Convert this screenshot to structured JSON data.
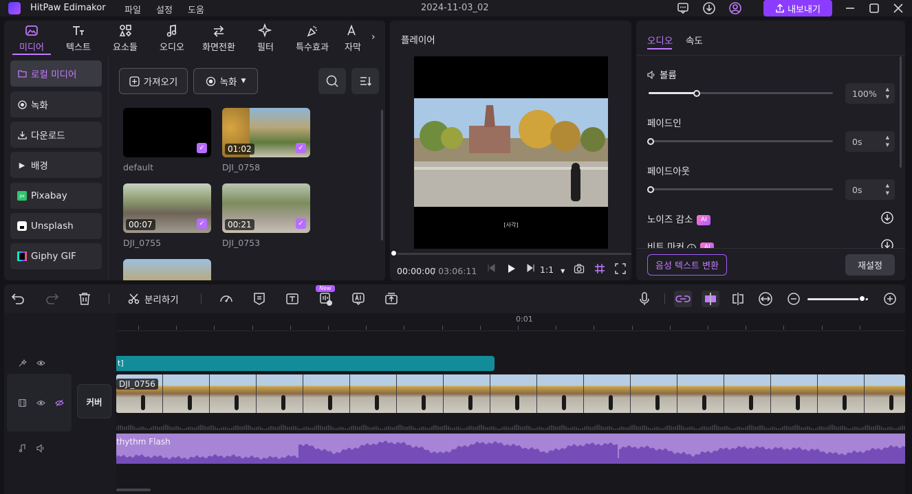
{
  "titlebar": {
    "app_name": "HitPaw Edimakor",
    "menu": [
      "파일",
      "설정",
      "도움"
    ],
    "doc_title": "2024-11-03_02",
    "export_label": "내보내기"
  },
  "tabs": [
    {
      "label": "미디어",
      "icon": "media-icon",
      "active": true
    },
    {
      "label": "텍스트",
      "icon": "text-icon"
    },
    {
      "label": "요소들",
      "icon": "elements-icon"
    },
    {
      "label": "오디오",
      "icon": "audio-icon"
    },
    {
      "label": "화면전환",
      "icon": "transition-icon"
    },
    {
      "label": "필터",
      "icon": "filter-icon"
    },
    {
      "label": "특수효과",
      "icon": "effects-icon"
    },
    {
      "label": "자막",
      "icon": "subtitle-icon"
    }
  ],
  "sidebar": {
    "items": [
      {
        "label": "로컬 미디어",
        "active": true
      },
      {
        "label": "녹화"
      },
      {
        "label": "다운로드"
      },
      {
        "label": "배경"
      },
      {
        "label": "Pixabay"
      },
      {
        "label": "Unsplash"
      },
      {
        "label": "Giphy GIF"
      }
    ]
  },
  "media": {
    "import_label": "가져오기",
    "record_label": "녹화",
    "items": [
      {
        "name": "default",
        "duration": ""
      },
      {
        "name": "DJI_0758",
        "duration": "01:02"
      },
      {
        "name": "DJI_0755",
        "duration": "00:07"
      },
      {
        "name": "DJI_0753",
        "duration": "00:21"
      }
    ]
  },
  "player": {
    "title": "플레이어",
    "caption": "[사각]",
    "time_current": "00:00:00",
    "time_total": "/ 03:06:11",
    "speed": "1:1",
    "progress": 0
  },
  "properties": {
    "tabs": [
      "오디오",
      "속도"
    ],
    "volume_label": "볼륨",
    "volume_value": "100%",
    "volume_fraction": 0.26,
    "fade_in_label": "페이드인",
    "fade_in_value": "0s",
    "fade_out_label": "페이드아웃",
    "fade_out_value": "0s",
    "noise_label": "노이즈 감소",
    "beat_label": "비트 마커",
    "ai_badge": "AI",
    "stt_label": "음성 텍스트 변환",
    "reset_label": "재설정"
  },
  "toolbar": {
    "split_label": "분리하기",
    "new_badge": "New",
    "zoom_fraction": 0.9
  },
  "timeline": {
    "ruler_label": "0:01",
    "text_clip": "t]",
    "video_clip": "DJI_0756",
    "audio_clip": "thythm Flash",
    "cover_label": "커버"
  },
  "colors": {
    "accent": "#c47bff",
    "export": "#8c3cff",
    "text_track": "#138c9a",
    "audio_track": "#a784d6"
  }
}
